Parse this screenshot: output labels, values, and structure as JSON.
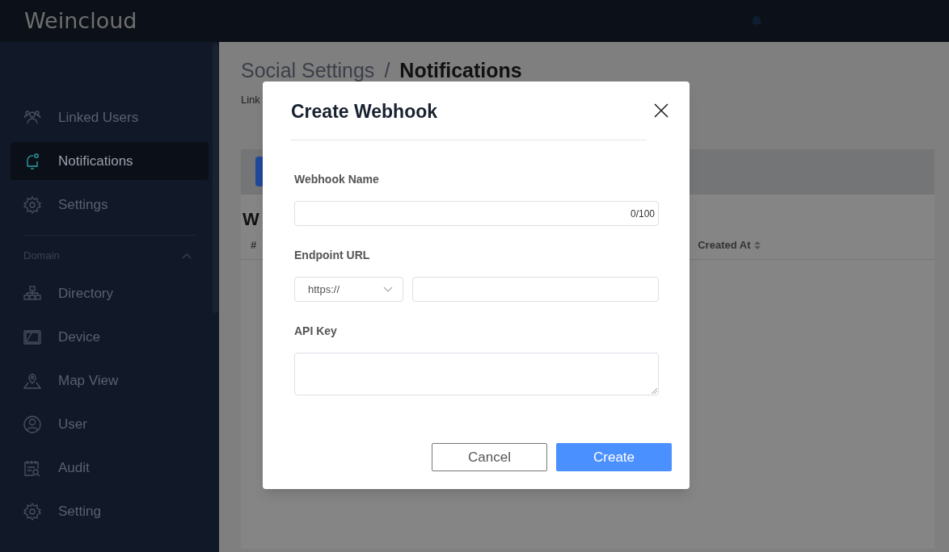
{
  "header": {
    "logo": "Weincloud"
  },
  "sidebar": {
    "items": [
      {
        "label": "Linked Users",
        "selected": false
      },
      {
        "label": "Notifications",
        "selected": true
      },
      {
        "label": "Settings",
        "selected": false
      }
    ],
    "section": {
      "title": "Domain",
      "expanded": true,
      "items": [
        {
          "label": "Directory",
          "selected": false
        },
        {
          "label": "Device",
          "selected": false
        },
        {
          "label": "Map View",
          "selected": false
        },
        {
          "label": "User",
          "selected": false
        },
        {
          "label": "Audit",
          "selected": false
        },
        {
          "label": "Setting",
          "selected": false
        }
      ]
    }
  },
  "page": {
    "breadcrumb": [
      "Social Settings",
      "Notifications"
    ],
    "separator": "/",
    "subtitle": "Link",
    "heading": "W",
    "table": {
      "columns": [
        "#",
        "Created At"
      ]
    }
  },
  "dialog": {
    "title": "Create Webhook",
    "fields": [
      {
        "kind": "text",
        "label": "Webhook Name",
        "counter": "0/100"
      },
      {
        "kind": "url",
        "label": "Endpoint URL",
        "scheme": "https://"
      },
      {
        "kind": "textarea",
        "label": "API Key"
      }
    ],
    "buttons": [
      {
        "label": "Cancel",
        "kind": "secondary"
      },
      {
        "label": "Create",
        "kind": "primary"
      }
    ]
  }
}
